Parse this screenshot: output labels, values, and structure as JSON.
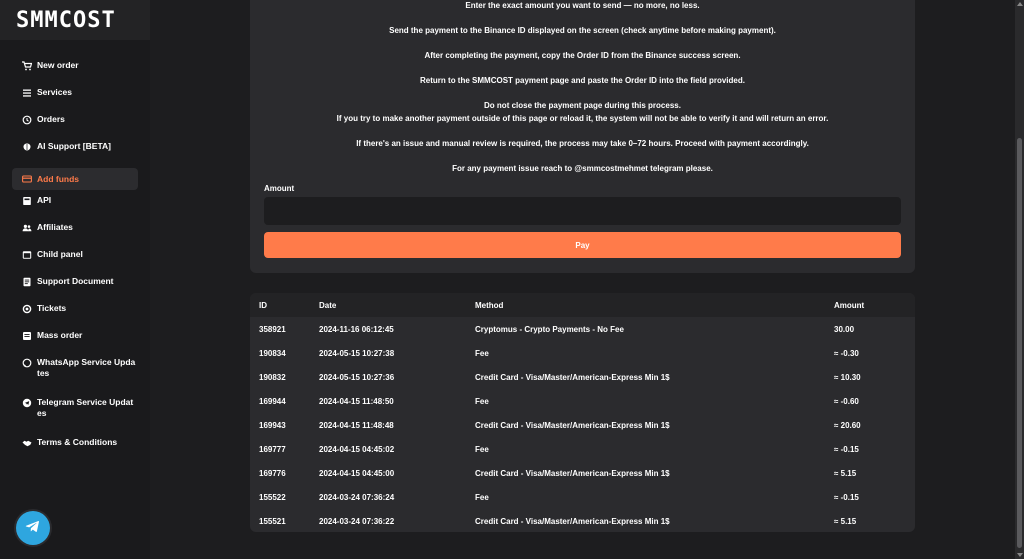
{
  "app": {
    "logo": "SMMCOST"
  },
  "sidebar": {
    "items": [
      {
        "label": "New order",
        "icon": "cart-icon"
      },
      {
        "label": "Services",
        "icon": "list-icon"
      },
      {
        "label": "Orders",
        "icon": "history-icon"
      },
      {
        "label": "AI Support [BETA]",
        "icon": "brain-icon"
      },
      {
        "label": "Add funds",
        "icon": "credit-card-icon",
        "active": true
      },
      {
        "label": "API",
        "icon": "book-icon"
      },
      {
        "label": "Affiliates",
        "icon": "users-icon"
      },
      {
        "label": "Child panel",
        "icon": "window-icon"
      },
      {
        "label": "Support Document",
        "icon": "document-icon"
      },
      {
        "label": "Tickets",
        "icon": "ticket-icon"
      },
      {
        "label": "Mass order",
        "icon": "mass-order-icon"
      },
      {
        "label": "WhatsApp Service Updates",
        "label_line1": "WhatsApp Service Upda",
        "label_line2": "tes",
        "icon": "whatsapp-icon"
      },
      {
        "label": "Telegram Service Updates",
        "label_line1": "Telegram Service Updat",
        "label_line2": "es",
        "icon": "telegram-icon"
      },
      {
        "label": "Terms & Conditions",
        "icon": "handshake-icon"
      }
    ]
  },
  "instructions": [
    "Enter the exact amount you want to send — no more, no less.",
    "Send the payment to the Binance ID displayed on the screen (check anytime before making payment).",
    "After completing the payment, copy the Order ID from the Binance success screen.",
    "Return to the SMMCOST payment page and paste the Order ID into the field provided.",
    "Do not close the payment page during this process.",
    "If you try to make another payment outside of this page or reload it, the system will not be able to verify it and will return an error.",
    "If there's an issue and manual review is required, the process may take 0–72 hours. Proceed with payment accordingly.",
    "For any payment issue reach to @smmcostmehmet telegram please."
  ],
  "form": {
    "amount_label": "Amount",
    "amount_value": "",
    "pay_label": "Pay"
  },
  "history": {
    "headers": {
      "id": "ID",
      "date": "Date",
      "method": "Method",
      "amount": "Amount"
    },
    "rows": [
      {
        "id": "358921",
        "date": "2024-11-16 06:12:45",
        "method": "Cryptomus - Crypto Payments - No Fee",
        "amount": "30.00"
      },
      {
        "id": "190834",
        "date": "2024-05-15 10:27:38",
        "method": "Fee",
        "amount": "≈ -0.30"
      },
      {
        "id": "190832",
        "date": "2024-05-15 10:27:36",
        "method": "Credit Card - Visa/Master/American-Express Min 1$",
        "amount": "≈ 10.30"
      },
      {
        "id": "169944",
        "date": "2024-04-15 11:48:50",
        "method": "Fee",
        "amount": "≈ -0.60"
      },
      {
        "id": "169943",
        "date": "2024-04-15 11:48:48",
        "method": "Credit Card - Visa/Master/American-Express Min 1$",
        "amount": "≈ 20.60"
      },
      {
        "id": "169777",
        "date": "2024-04-15 04:45:02",
        "method": "Fee",
        "amount": "≈ -0.15"
      },
      {
        "id": "169776",
        "date": "2024-04-15 04:45:00",
        "method": "Credit Card - Visa/Master/American-Express Min 1$",
        "amount": "≈ 5.15"
      },
      {
        "id": "155522",
        "date": "2024-03-24 07:36:24",
        "method": "Fee",
        "amount": "≈ -0.15"
      },
      {
        "id": "155521",
        "date": "2024-03-24 07:36:22",
        "method": "Credit Card - Visa/Master/American-Express Min 1$",
        "amount": "≈ 5.15"
      }
    ]
  },
  "colors": {
    "accent": "#ff7b4a",
    "telegram": "#2ea6df",
    "panel": "#2b2b2e",
    "background": "#1d1d1f"
  }
}
